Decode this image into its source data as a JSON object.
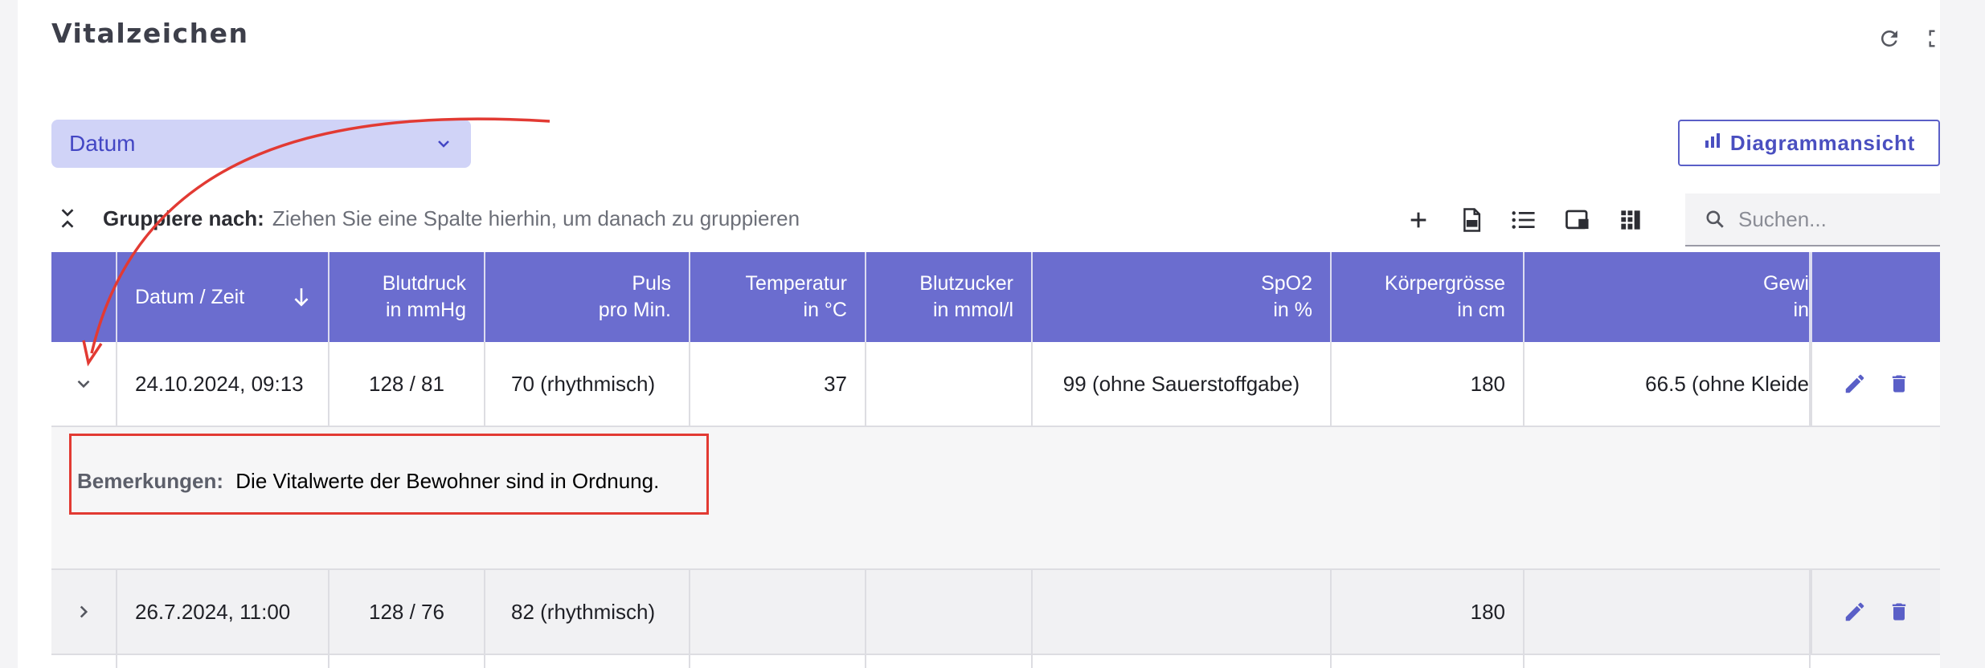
{
  "page": {
    "title": "Vitalzeichen"
  },
  "filter": {
    "selected": "Datum"
  },
  "actions": {
    "diagram_label": "Diagrammansicht"
  },
  "grouping": {
    "label": "Gruppiere nach:",
    "hint": "Ziehen Sie eine Spalte hierhin, um danach zu gruppieren"
  },
  "search": {
    "placeholder": "Suchen..."
  },
  "columns": [
    {
      "line1": "Datum / Zeit",
      "line2": ""
    },
    {
      "line1": "Blutdruck",
      "line2": "in mmHg"
    },
    {
      "line1": "Puls",
      "line2": "pro Min."
    },
    {
      "line1": "Temperatur",
      "line2": "in °C"
    },
    {
      "line1": "Blutzucker",
      "line2": "in mmol/l"
    },
    {
      "line1": "SpO2",
      "line2": "in %"
    },
    {
      "line1": "Körpergrösse",
      "line2": "in cm"
    },
    {
      "line1": "Gewi",
      "line2": "in"
    }
  ],
  "rows": [
    {
      "datum": "24.10.2024, 09:13",
      "blutdruck": "128 / 81",
      "puls": "70 (rhythmisch)",
      "temperatur": "37",
      "blutzucker": "",
      "spo2": "99 (ohne Sauerstoffgabe)",
      "groesse": "180",
      "gewicht": "66.5 (ohne Kleide",
      "expanded": true,
      "remark_label": "Bemerkungen:",
      "remark_text": "Die Vitalwerte der Bewohner sind in Ordnung."
    },
    {
      "datum": "26.7.2024, 11:00",
      "blutdruck": "128 / 76",
      "puls": "82 (rhythmisch)",
      "temperatur": "",
      "blutzucker": "",
      "spo2": "",
      "groesse": "180",
      "gewicht": "",
      "expanded": false
    }
  ],
  "colors": {
    "header_bg": "#6b6dcf",
    "accent": "#5a5fc7",
    "annotation": "#e23a33"
  },
  "icons": [
    "refresh-icon",
    "fullscreen-icon",
    "chevron-down-icon",
    "bar-chart-icon",
    "collapse-expand-icon",
    "plus-icon",
    "pdf-icon",
    "list-icon",
    "column-chooser-icon",
    "grid-icon",
    "search-icon",
    "sort-down-arrow-icon",
    "edit-icon",
    "delete-icon",
    "chevron-right-icon"
  ]
}
